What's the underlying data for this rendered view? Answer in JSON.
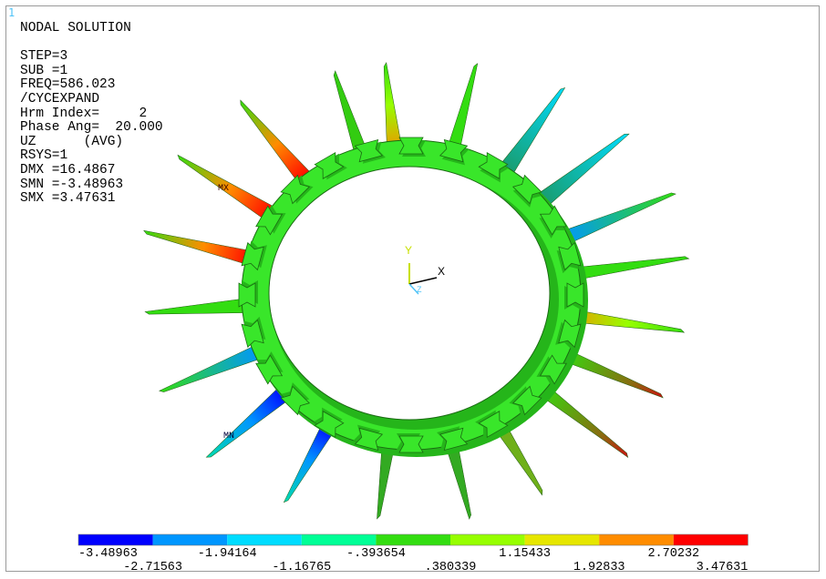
{
  "window_number": "1",
  "info_lines": [
    "NODAL SOLUTION",
    "",
    "STEP=3",
    "SUB =1",
    "FREQ=586.023",
    "/CYCEXPAND",
    "Hrm Index=     2",
    "Phase Ang=  20.000",
    "UZ      (AVG)",
    "RSYS=1",
    "DMX =16.4867",
    "SMN =-3.48963",
    "SMX =3.47631"
  ],
  "triad": {
    "y_label": "Y",
    "x_label": "X",
    "z_label": "Z"
  },
  "markers": {
    "max_label": "MX",
    "min_label": "MN"
  },
  "legend": {
    "colors": [
      "#0000ff",
      "#0096ff",
      "#00dcff",
      "#00ff96",
      "#33dd11",
      "#96ff00",
      "#e6e600",
      "#ff8c00",
      "#ff0000"
    ],
    "values_top": [
      "-3.48963",
      "-1.94164",
      "-.393654",
      "1.15433",
      "2.70232"
    ],
    "values_bottom": [
      "-2.71563",
      "-1.16765",
      ".380339",
      "1.92833",
      "3.47631"
    ]
  },
  "colors": {
    "ring": "#39e62a",
    "ring_dark": "#25b51a",
    "ring_edge": "#1a6b12"
  }
}
